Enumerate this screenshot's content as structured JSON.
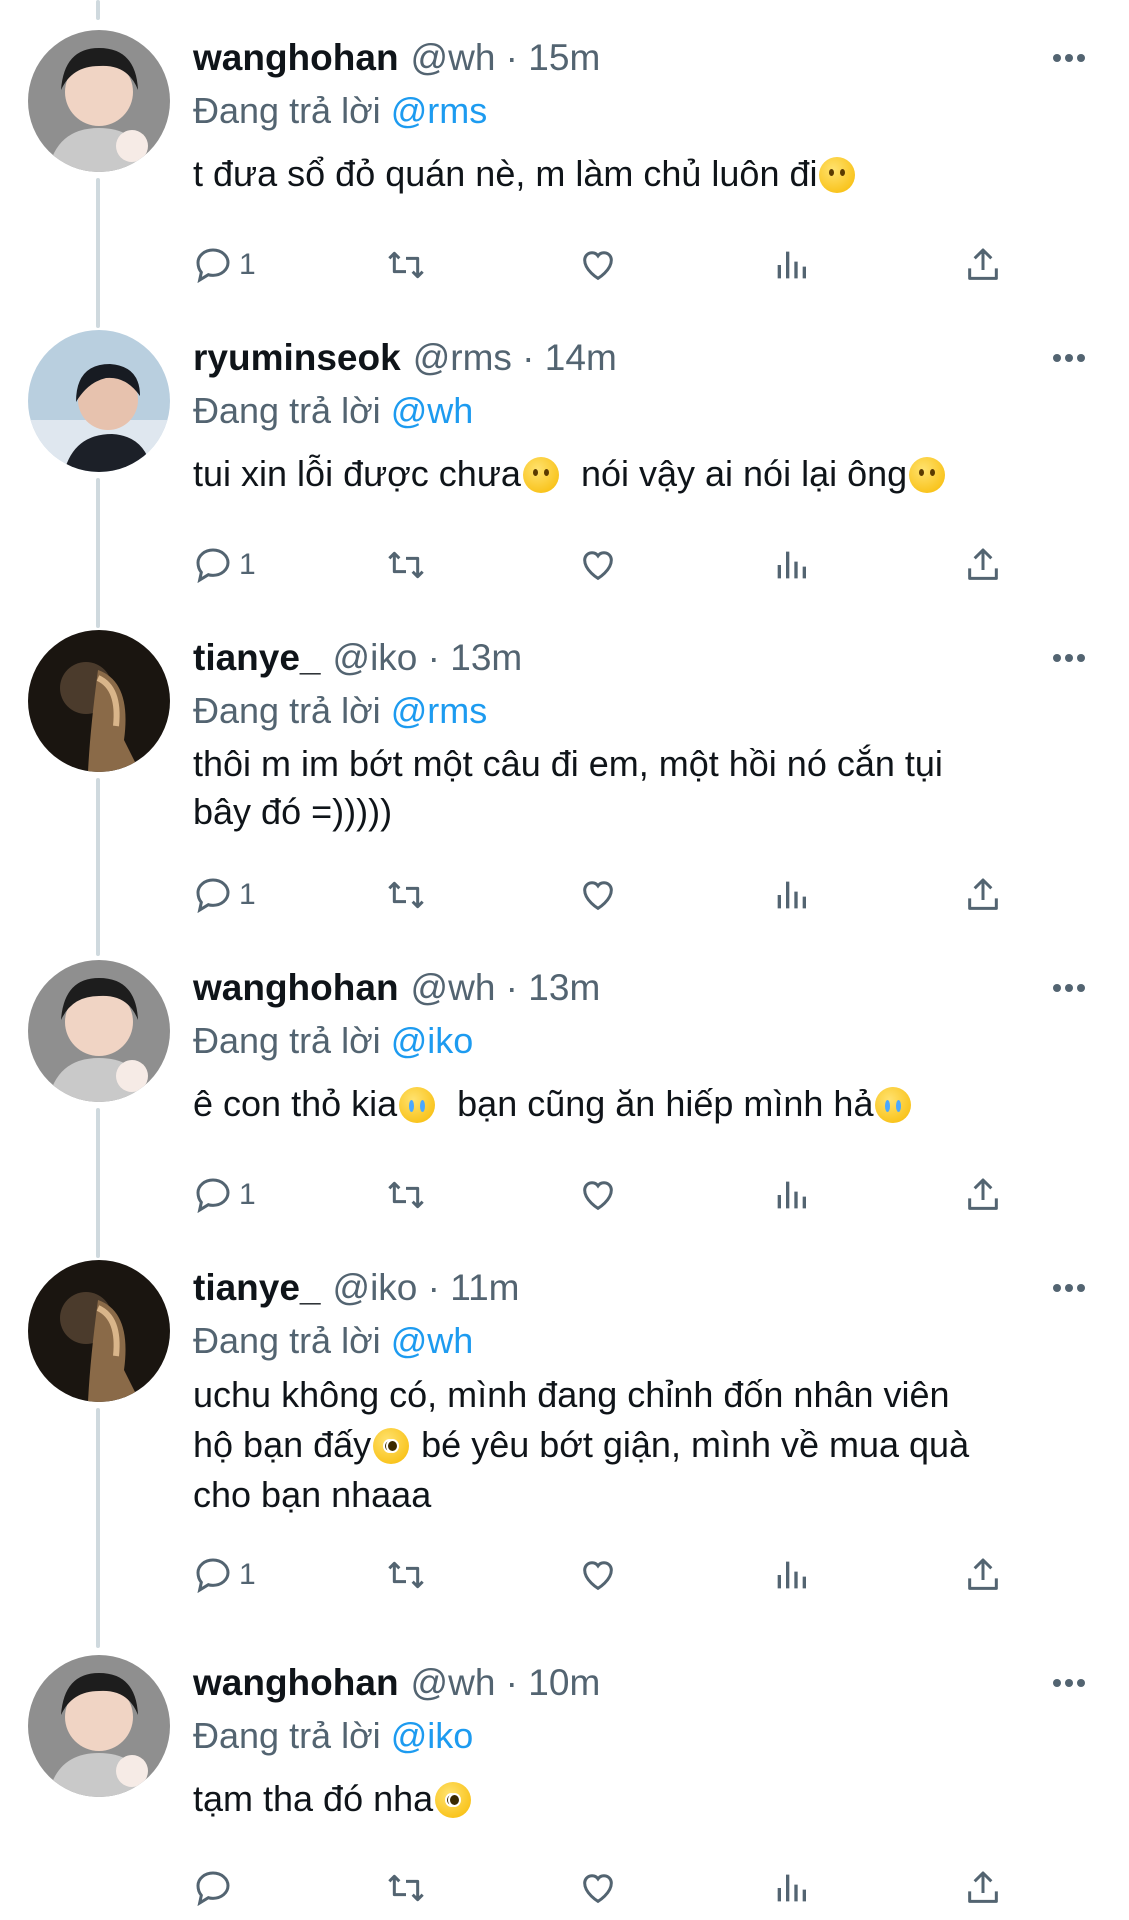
{
  "tweets": [
    {
      "name": "wanghohan",
      "meta": "@wh · 15m",
      "reply_prefix": "Đang trả lời",
      "reply_to": "@rms",
      "text_parts": [
        "t đưa sổ đỏ quán nè, m làm chủ luôn đi"
      ],
      "reply_count": "1",
      "avatar": "wanghohan-avatar"
    },
    {
      "name": "ryuminseok",
      "meta": "@rms · 14m",
      "reply_prefix": "Đang trả lời",
      "reply_to": "@wh",
      "text_parts": [
        "tui xin lỗi được chưa",
        "  nói vậy ai nói lại ông"
      ],
      "reply_count": "1",
      "avatar": "ryuminseok-avatar"
    },
    {
      "name": "tianye_",
      "meta": "@iko · 13m",
      "reply_prefix": "Đang trả lời",
      "reply_to": "@rms",
      "text_parts": [
        "thôi m im bớt một câu đi em, một hồi nó cắn tụi\nbây đó =)))))"
      ],
      "reply_count": "1",
      "avatar": "tianye-avatar"
    },
    {
      "name": "wanghohan",
      "meta": "@wh · 13m",
      "reply_prefix": "Đang trả lời",
      "reply_to": "@iko",
      "text_parts": [
        "ê con thỏ kia",
        "  bạn cũng ăn hiếp mình hả"
      ],
      "reply_count": "1",
      "avatar": "wanghohan-avatar"
    },
    {
      "name": "tianye_",
      "meta": "@iko · 11m",
      "reply_prefix": "Đang trả lời",
      "reply_to": "@wh",
      "text_parts": [
        "uchu không có, mình đang chỉnh đốn nhân viên\nhộ bạn đấy",
        " bé yêu bớt giận, mình về mua quà\ncho bạn nhaaa"
      ],
      "reply_count": "1",
      "avatar": "tianye-avatar"
    },
    {
      "name": "wanghohan",
      "meta": "@wh · 10m",
      "reply_prefix": "Đang trả lời",
      "reply_to": "@iko",
      "text_parts": [
        "tạm tha đó nha"
      ],
      "reply_count": "",
      "avatar": "wanghohan-avatar"
    }
  ],
  "colors": {
    "link": "#1d9bf0",
    "secondary": "#536471",
    "line": "#cfd9de"
  },
  "icons": [
    "reply-icon",
    "retweet-icon",
    "like-icon",
    "views-icon",
    "share-icon",
    "more-icon"
  ]
}
